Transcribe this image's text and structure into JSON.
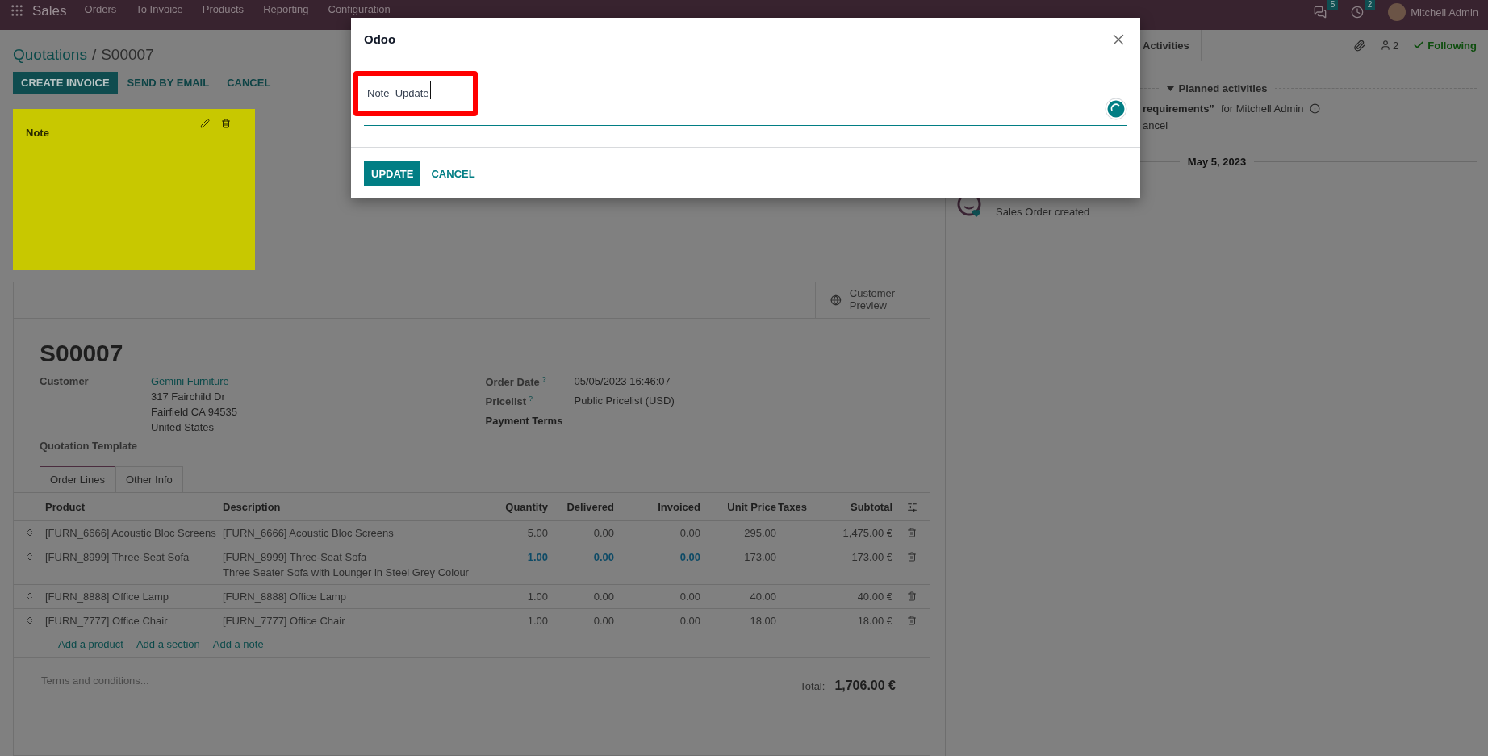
{
  "navbar": {
    "app": "Sales",
    "menu": [
      "Orders",
      "To Invoice",
      "Products",
      "Reporting",
      "Configuration"
    ],
    "messages_count": "5",
    "activities_count": "2",
    "user": "Mitchell Admin"
  },
  "breadcrumb": {
    "parent": "Quotations",
    "separator": "/",
    "current": "S00007"
  },
  "actions": [
    {
      "label": "CREATE INVOICE",
      "primary": true
    },
    {
      "label": "SEND BY EMAIL",
      "primary": false
    },
    {
      "label": "CANCEL",
      "primary": false
    }
  ],
  "sticky_note": {
    "title": "Note"
  },
  "smart_button": {
    "label": "Customer Preview"
  },
  "order": {
    "name": "S00007",
    "fields_left": [
      {
        "label": "Customer",
        "value": "Gemini Furniture",
        "address": [
          "317 Fairchild Dr",
          "Fairfield CA 94535",
          "United States"
        ]
      },
      {
        "label": "Quotation Template"
      }
    ],
    "fields_right": [
      {
        "label": "Order Date",
        "help": "?",
        "value": "05/05/2023 16:46:07"
      },
      {
        "label": "Pricelist",
        "help": "?",
        "value": "Public Pricelist (USD)"
      },
      {
        "label": "Payment Terms"
      }
    ]
  },
  "tabs": [
    {
      "label": "Order Lines",
      "selected": true
    },
    {
      "label": "Other Info",
      "selected": false
    }
  ],
  "table": {
    "columns": [
      "Product",
      "Description",
      "Quantity",
      "Delivered",
      "Invoiced",
      "Unit Price",
      "Taxes",
      "Subtotal"
    ],
    "rows": [
      {
        "product": "[FURN_6666] Acoustic Bloc Screens",
        "description": [
          "[FURN_6666] Acoustic Bloc Screens"
        ],
        "quantity": "5.00",
        "delivered": "0.00",
        "invoiced": "0.00",
        "unit_price": "295.00",
        "subtotal": "1,475.00 €",
        "emphasized": false
      },
      {
        "product": "[FURN_8999] Three-Seat Sofa",
        "description": [
          "[FURN_8999] Three-Seat Sofa",
          "Three Seater Sofa with Lounger in Steel Grey Colour"
        ],
        "quantity": "1.00",
        "delivered": "0.00",
        "invoiced": "0.00",
        "unit_price": "173.00",
        "subtotal": "173.00 €",
        "emphasized": true
      },
      {
        "product": "[FURN_8888] Office Lamp",
        "description": [
          "[FURN_8888] Office Lamp"
        ],
        "quantity": "1.00",
        "delivered": "0.00",
        "invoiced": "0.00",
        "unit_price": "40.00",
        "subtotal": "40.00 €",
        "emphasized": false
      },
      {
        "product": "[FURN_7777] Office Chair",
        "description": [
          "[FURN_7777] Office Chair"
        ],
        "quantity": "1.00",
        "delivered": "0.00",
        "invoiced": "0.00",
        "unit_price": "18.00",
        "subtotal": "18.00 €",
        "emphasized": false
      }
    ],
    "add_links": [
      "Add a product",
      "Add a section",
      "Add a note"
    ]
  },
  "footer": {
    "terms_placeholder": "Terms and conditions...",
    "total_label": "Total:",
    "total_value": "1,706.00 €"
  },
  "chatter": {
    "activities_button": "Activities",
    "followers_count": "2",
    "following": "Following",
    "planned_title": "Planned activities",
    "activity": {
      "summary": "requirements”",
      "assignee": "for Mitchell Admin",
      "action": "ancel"
    },
    "date": "May 5, 2023",
    "message": "Sales Order created"
  },
  "dialog": {
    "title": "Odoo",
    "value": "Note  Update",
    "buttons": [
      {
        "label": "UPDATE",
        "primary": true
      },
      {
        "label": "CANCEL",
        "primary": false
      }
    ]
  }
}
